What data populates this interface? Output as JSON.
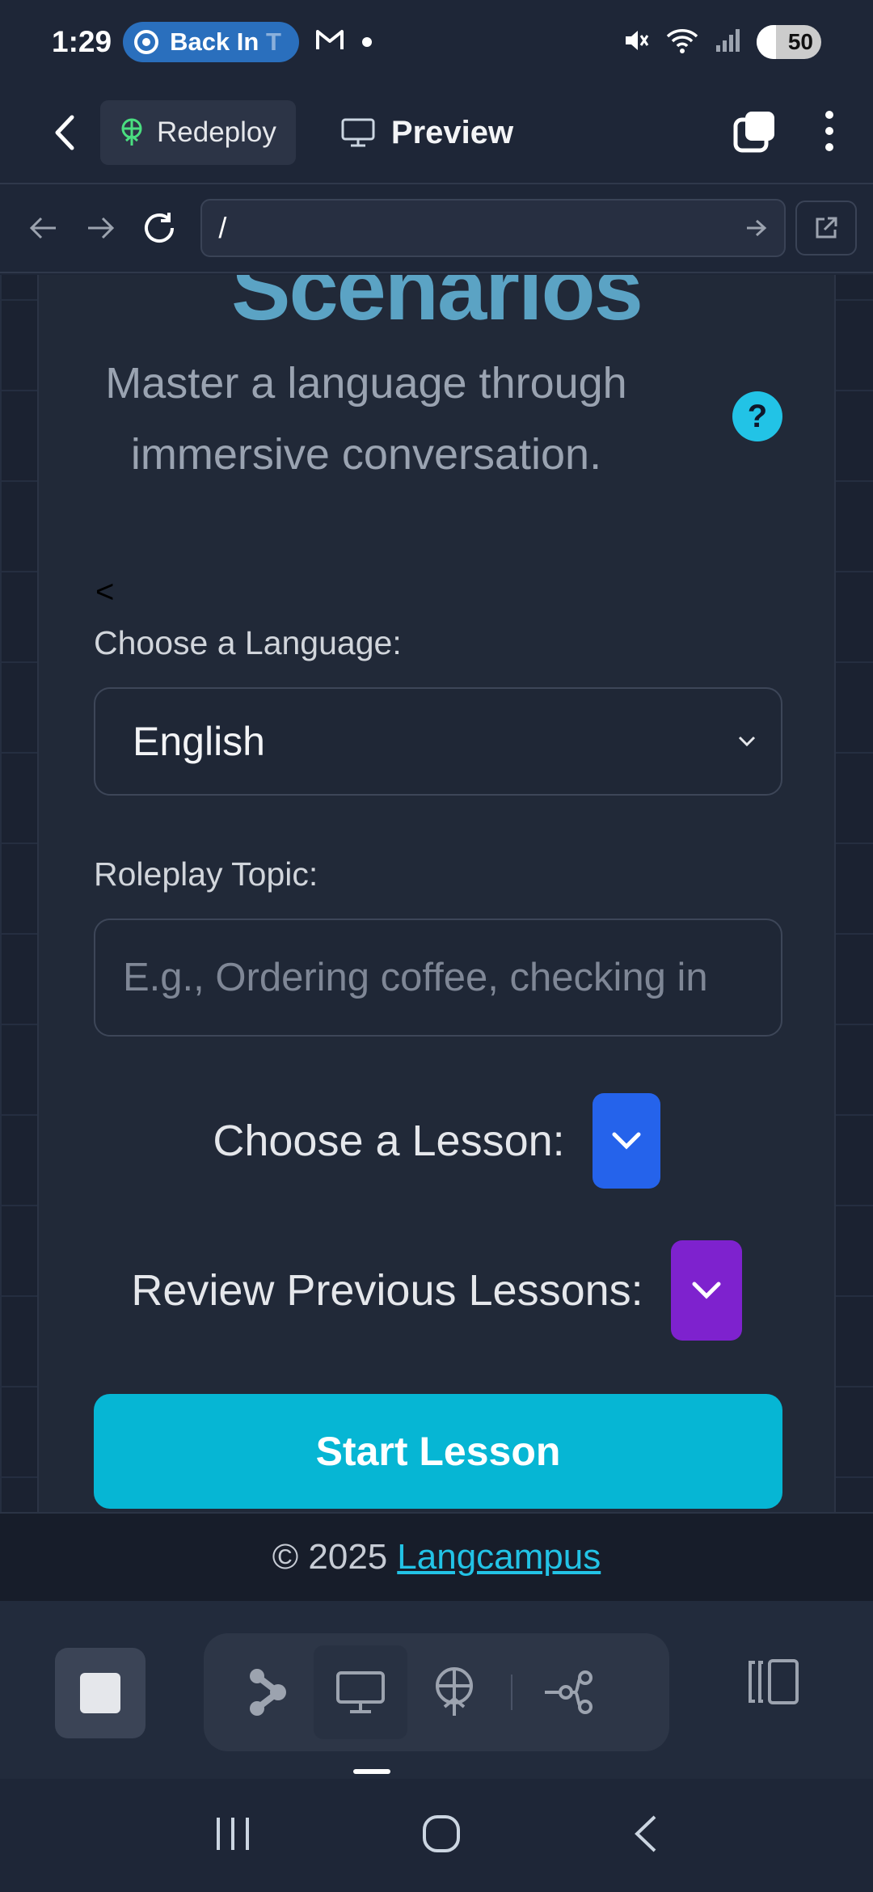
{
  "status_bar": {
    "time": "1:29",
    "pill_text": "Back In",
    "pill_text_faded": "T",
    "battery": "50"
  },
  "app_bar": {
    "redeploy_label": "Redeploy",
    "preview_label": "Preview"
  },
  "url_bar": {
    "url": "/"
  },
  "page": {
    "hero_title": "Scenarios",
    "subtitle": "Master a language through immersive conversation.",
    "help_label": "?",
    "collapse_label": "<",
    "language_label": "Choose a Language:",
    "language_value": "English",
    "topic_label": "Roleplay Topic:",
    "topic_placeholder": "E.g., Ordering coffee, checking in",
    "lesson_label": "Choose a Lesson:",
    "review_label": "Review Previous Lessons:",
    "start_label": "Start Lesson"
  },
  "footer": {
    "copyright": "© 2025",
    "link": "Langcampus"
  },
  "colors": {
    "accent_cyan": "#06b6d4",
    "lesson_button": "#2563eb",
    "review_button": "#7e22ce",
    "title_blue": "#5ba3c4"
  }
}
